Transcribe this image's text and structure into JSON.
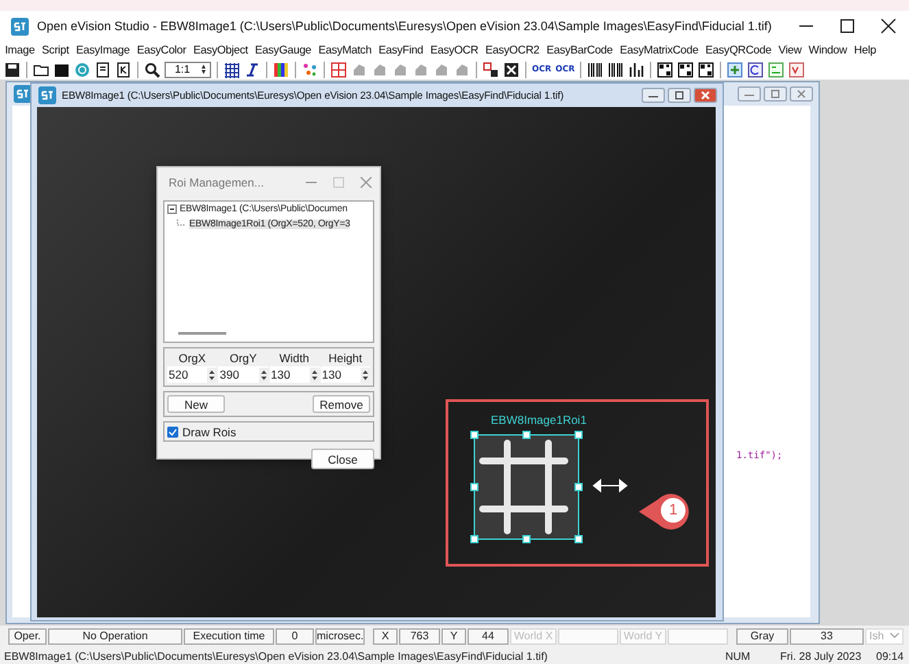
{
  "window": {
    "title": "Open eVision Studio - EBW8Image1 (C:\\Users\\Public\\Documents\\Euresys\\Open eVision 23.04\\Sample Images\\EasyFind\\Fiducial 1.tif)"
  },
  "menu": [
    "Image",
    "Script",
    "EasyImage",
    "EasyColor",
    "EasyObject",
    "EasyGauge",
    "EasyMatch",
    "EasyFind",
    "EasyOCR",
    "EasyOCR2",
    "EasyBarCode",
    "EasyMatrixCode",
    "EasyQRCode",
    "View",
    "Window",
    "Help"
  ],
  "toolbar": {
    "zoom": "1:1",
    "ocr_buttons": [
      "OCR",
      "OCR"
    ]
  },
  "script_window": {
    "code_fragment": "1.tif\");"
  },
  "image_window": {
    "title": "EBW8Image1 (C:\\Users\\Public\\Documents\\Euresys\\Open eVision 23.04\\Sample Images\\EasyFind\\Fiducial 1.tif)",
    "roi_label": "EBW8Image1Roi1",
    "callout": "1"
  },
  "roi_dialog": {
    "title": "Roi Managemen...",
    "tree": [
      {
        "label": "EBW8Image1 (C:\\Users\\Public\\Documen",
        "expanded": true,
        "children": [
          {
            "label": "EBW8Image1Roi1 (OrgX=520, OrgY=3",
            "selected": true
          }
        ]
      }
    ],
    "fields": [
      {
        "label": "OrgX",
        "value": "520"
      },
      {
        "label": "OrgY",
        "value": "390"
      },
      {
        "label": "Width",
        "value": "130"
      },
      {
        "label": "Height",
        "value": "130"
      }
    ],
    "new_button": "New",
    "remove_button": "Remove",
    "draw_rois": {
      "label": "Draw Rois",
      "checked": true
    },
    "close_button": "Close"
  },
  "status_bar": {
    "fields": [
      {
        "text": "Oper."
      },
      {
        "text": "No Operation"
      },
      {
        "text": "Execution time"
      },
      {
        "text": "0"
      },
      {
        "text": "microsec."
      },
      {
        "text": "X"
      },
      {
        "text": "763"
      },
      {
        "text": "Y"
      },
      {
        "text": "44"
      },
      {
        "text": "World X",
        "disabled": true
      },
      {
        "disabled": true
      },
      {
        "text": "World Y",
        "disabled": true
      },
      {
        "disabled": true
      },
      {
        "text": "Gray"
      },
      {
        "text": "33"
      }
    ],
    "channel": "Ish"
  },
  "bottom_bar": {
    "path": "EBW8Image1 (C:\\Users\\Public\\Documents\\Euresys\\Open eVision 23.04\\Sample Images\\EasyFind\\Fiducial 1.tif)",
    "num": "NUM",
    "date": "Fri. 28 July 2023",
    "time": "09:14"
  }
}
